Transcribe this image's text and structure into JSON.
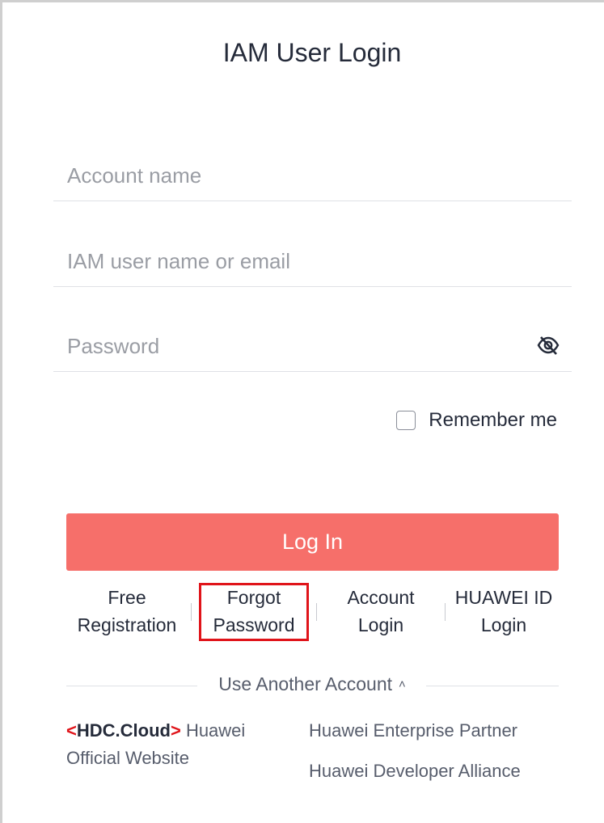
{
  "title": "IAM User Login",
  "form": {
    "account_placeholder": "Account name",
    "account_value": "",
    "iam_user_placeholder": "IAM user name or email",
    "iam_user_value": "",
    "password_placeholder": "Password",
    "password_value": "",
    "remember_label": "Remember me",
    "remember_checked": false,
    "login_label": "Log In"
  },
  "links": [
    {
      "line1": "Free",
      "line2": "Registration"
    },
    {
      "line1": "Forgot",
      "line2": "Password"
    },
    {
      "line1": "Account",
      "line2": "Login"
    },
    {
      "line1": "HUAWEI ID",
      "line2": "Login"
    }
  ],
  "other_accounts": {
    "label": "Use Another Account",
    "hdc_logo": {
      "open": "<",
      "text": "HDC.Cloud",
      "close": ">"
    },
    "hdc_site": "Huawei Official Website",
    "enterprise_partner": "Huawei Enterprise Partner",
    "developer_alliance": "Huawei Developer Alliance"
  },
  "colors": {
    "login_button": "#f66f6a",
    "highlight_box": "#e0141a"
  }
}
